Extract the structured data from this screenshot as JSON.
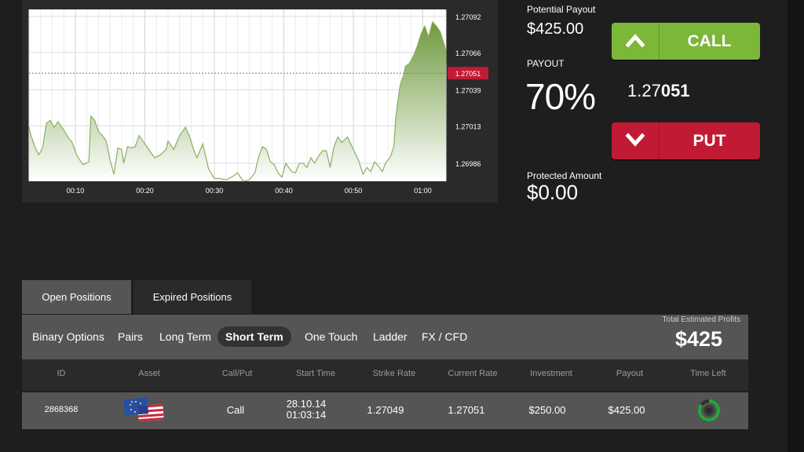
{
  "chart": {
    "y_ticks": [
      "1.27092",
      "1.27066",
      "1.27039",
      "1.27013",
      "1.26986"
    ],
    "x_ticks": [
      "00:10",
      "00:20",
      "00:30",
      "00:40",
      "00:50",
      "01:00"
    ],
    "current_value_badge": "1.27051",
    "line_color": "#8ab060",
    "badge_color": "#c11a34"
  },
  "chart_data": {
    "type": "area",
    "x_unit": "seconds",
    "x": [
      0,
      1,
      3,
      5,
      7,
      9,
      11,
      13,
      15,
      18,
      21,
      22,
      25,
      28,
      31,
      32,
      34,
      36,
      38,
      40,
      42,
      44,
      46,
      48,
      49,
      51,
      53,
      55,
      57,
      60,
      62,
      65,
      68,
      71,
      72,
      74,
      75,
      78,
      81,
      83,
      85,
      87,
      90,
      93,
      96,
      99,
      102,
      105,
      108,
      111,
      114,
      117,
      119,
      121,
      123,
      125,
      127,
      129,
      131,
      133,
      136,
      138,
      140,
      142,
      144,
      146,
      148,
      150,
      152,
      154,
      156,
      158,
      160,
      162,
      165,
      168,
      171,
      173,
      175,
      177,
      179,
      181,
      183,
      185,
      187,
      189,
      190,
      191,
      192,
      193,
      194,
      195,
      197,
      199,
      201,
      203,
      205,
      207,
      209,
      211,
      213,
      215,
      217,
      219,
      221
    ],
    "values": [
      1.27012,
      1.27006,
      1.26998,
      1.26992,
      1.26997,
      1.27015,
      1.27017,
      1.27012,
      1.27016,
      1.2701,
      1.27003,
      1.27002,
      1.26991,
      1.26985,
      1.26987,
      1.2702,
      1.27017,
      1.27009,
      1.27006,
      1.27002,
      1.26988,
      1.26978,
      1.26997,
      1.26996,
      1.26986,
      1.26998,
      1.26997,
      1.26998,
      1.27006,
      1.27,
      1.26996,
      1.2699,
      1.26992,
      1.26996,
      1.27002,
      1.26998,
      1.26996,
      1.27006,
      1.27012,
      1.27006,
      1.26997,
      1.2699,
      1.27,
      1.26982,
      1.26975,
      1.26975,
      1.26974,
      1.26976,
      1.26979,
      1.26973,
      1.26974,
      1.26979,
      1.26991,
      1.26998,
      1.26996,
      1.26987,
      1.26985,
      1.26979,
      1.26976,
      1.26986,
      1.2698,
      1.26979,
      1.26986,
      1.26986,
      1.26983,
      1.2699,
      1.26986,
      1.26991,
      1.26995,
      1.26995,
      1.26983,
      1.26998,
      1.27005,
      1.27001,
      1.27005,
      1.26996,
      1.26987,
      1.26978,
      1.26983,
      1.2698,
      1.26987,
      1.26984,
      1.2698,
      1.26987,
      1.2699,
      1.26998,
      1.27019,
      1.2703,
      1.2704,
      1.27046,
      1.27049,
      1.27056,
      1.27058,
      1.27063,
      1.2707,
      1.27079,
      1.27085,
      1.27077,
      1.27088,
      1.27085,
      1.27081,
      1.27072,
      1.27067,
      1.27063,
      1.27059,
      1.27057,
      1.27055,
      1.27053,
      1.27051
    ],
    "ylim": [
      1.26973,
      1.27097
    ],
    "xlim": [
      0,
      216
    ],
    "y_ticks": [
      1.27092,
      1.27066,
      1.27039,
      1.27013,
      1.26986
    ],
    "x_tick_labels": [
      "00:10",
      "00:20",
      "00:30",
      "00:40",
      "00:50",
      "01:00"
    ],
    "x_tick_values": [
      24,
      60,
      96,
      132,
      168,
      204
    ],
    "reference_line": 1.27051,
    "grid": true
  },
  "stats": {
    "potential_payout_label": "Potential Payout",
    "potential_payout_value": "$425.00",
    "payout_label": "PAYOUT",
    "payout_value": "70%",
    "protected_label": "Protected Amount",
    "protected_value": "$0.00"
  },
  "buttons": {
    "call_label": "CALL",
    "put_label": "PUT"
  },
  "current_rate": {
    "prefix": "1.27",
    "suffix": "051"
  },
  "tabs": {
    "open": "Open Positions",
    "expired": "Expired Positions"
  },
  "filters": [
    "Binary Options",
    "Pairs",
    "Long Term",
    "Short Term",
    "One Touch",
    "Ladder",
    "FX / CFD"
  ],
  "active_filter": "Short Term",
  "profits": {
    "label": "Total Estimated Profits",
    "value": "$425"
  },
  "table": {
    "headers": [
      "ID",
      "Asset",
      "Call/Put",
      "Start Time",
      "Strike Rate",
      "Current Rate",
      "Investment",
      "Payout",
      "Time Left"
    ],
    "rows": [
      {
        "id": "2868368",
        "asset_icon": "eu-us-flags-icon",
        "call_put": "Call",
        "start_date": "28.10.14",
        "start_time": "01:03:14",
        "strike_rate": "1.27049",
        "current_rate": "1.27051",
        "investment": "$250.00",
        "payout": "$425.00",
        "time_left_progress": 0.85
      }
    ]
  }
}
